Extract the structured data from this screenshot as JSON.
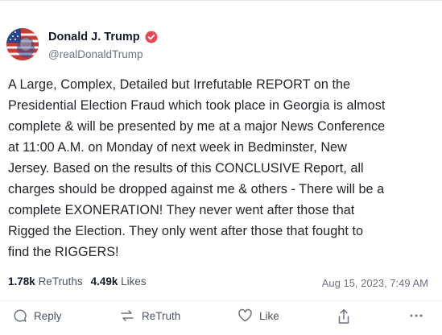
{
  "post": {
    "author_name": "Donald J. Trump",
    "author_handle": "@realDonaldTrump",
    "text": "A Large, Complex, Detailed but Irrefutable REPORT on the\nPresidential Election Fraud which took place in Georgia is almost\ncomplete & will be presented by me at a major News Conference\nat 11:00 A.M. on Monday of next week in Bedminster, New\nJersey. Based on the results of this CONCLUSIVE Report, all\ncharges should be dropped against me & others - There will be a\ncomplete EXONERATION! They never went after those that\nRigged the Election. They only went after those that fought to\nfind the RIGGERS!",
    "retruths_count": "1.78k",
    "retruths_label": "ReTruths",
    "likes_count": "4.49k",
    "likes_label": "Likes",
    "timestamp": "Aug 15, 2023, 7:49 AM"
  },
  "actions": {
    "reply_label": "Reply",
    "retruth_label": "ReTruth",
    "like_label": "Like"
  },
  "icons": {
    "verified": "verified-badge-icon",
    "reply": "reply-bubble-icon",
    "retruth": "retruth-arrows-icon",
    "like": "heart-icon",
    "share": "share-icon",
    "more": "more-dots-icon"
  },
  "colors": {
    "verified_badge": "#e8485c",
    "icon_gray": "#6b7280"
  }
}
